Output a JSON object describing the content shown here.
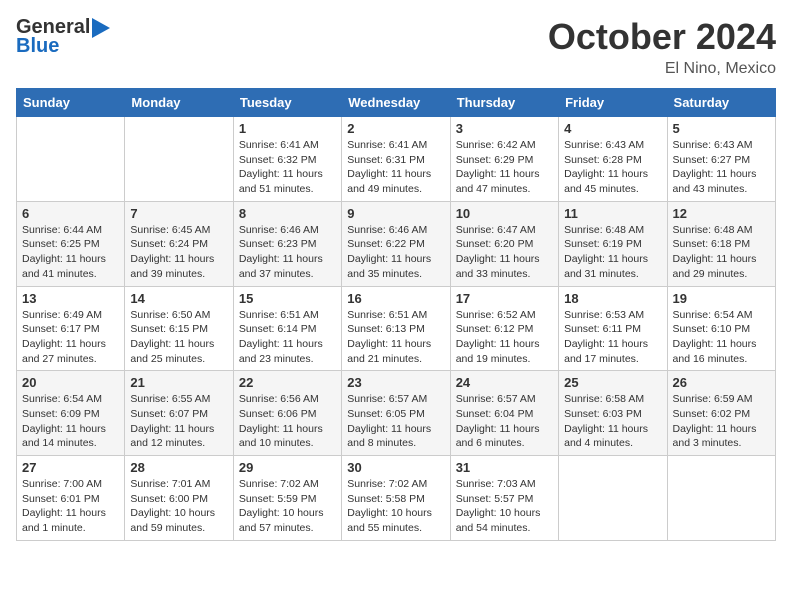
{
  "logo": {
    "general": "General",
    "blue": "Blue"
  },
  "header": {
    "month": "October 2024",
    "location": "El Nino, Mexico"
  },
  "weekdays": [
    "Sunday",
    "Monday",
    "Tuesday",
    "Wednesday",
    "Thursday",
    "Friday",
    "Saturday"
  ],
  "weeks": [
    [
      {
        "day": null
      },
      {
        "day": null
      },
      {
        "day": "1",
        "sunrise": "Sunrise: 6:41 AM",
        "sunset": "Sunset: 6:32 PM",
        "daylight": "Daylight: 11 hours and 51 minutes."
      },
      {
        "day": "2",
        "sunrise": "Sunrise: 6:41 AM",
        "sunset": "Sunset: 6:31 PM",
        "daylight": "Daylight: 11 hours and 49 minutes."
      },
      {
        "day": "3",
        "sunrise": "Sunrise: 6:42 AM",
        "sunset": "Sunset: 6:29 PM",
        "daylight": "Daylight: 11 hours and 47 minutes."
      },
      {
        "day": "4",
        "sunrise": "Sunrise: 6:43 AM",
        "sunset": "Sunset: 6:28 PM",
        "daylight": "Daylight: 11 hours and 45 minutes."
      },
      {
        "day": "5",
        "sunrise": "Sunrise: 6:43 AM",
        "sunset": "Sunset: 6:27 PM",
        "daylight": "Daylight: 11 hours and 43 minutes."
      }
    ],
    [
      {
        "day": "6",
        "sunrise": "Sunrise: 6:44 AM",
        "sunset": "Sunset: 6:25 PM",
        "daylight": "Daylight: 11 hours and 41 minutes."
      },
      {
        "day": "7",
        "sunrise": "Sunrise: 6:45 AM",
        "sunset": "Sunset: 6:24 PM",
        "daylight": "Daylight: 11 hours and 39 minutes."
      },
      {
        "day": "8",
        "sunrise": "Sunrise: 6:46 AM",
        "sunset": "Sunset: 6:23 PM",
        "daylight": "Daylight: 11 hours and 37 minutes."
      },
      {
        "day": "9",
        "sunrise": "Sunrise: 6:46 AM",
        "sunset": "Sunset: 6:22 PM",
        "daylight": "Daylight: 11 hours and 35 minutes."
      },
      {
        "day": "10",
        "sunrise": "Sunrise: 6:47 AM",
        "sunset": "Sunset: 6:20 PM",
        "daylight": "Daylight: 11 hours and 33 minutes."
      },
      {
        "day": "11",
        "sunrise": "Sunrise: 6:48 AM",
        "sunset": "Sunset: 6:19 PM",
        "daylight": "Daylight: 11 hours and 31 minutes."
      },
      {
        "day": "12",
        "sunrise": "Sunrise: 6:48 AM",
        "sunset": "Sunset: 6:18 PM",
        "daylight": "Daylight: 11 hours and 29 minutes."
      }
    ],
    [
      {
        "day": "13",
        "sunrise": "Sunrise: 6:49 AM",
        "sunset": "Sunset: 6:17 PM",
        "daylight": "Daylight: 11 hours and 27 minutes."
      },
      {
        "day": "14",
        "sunrise": "Sunrise: 6:50 AM",
        "sunset": "Sunset: 6:15 PM",
        "daylight": "Daylight: 11 hours and 25 minutes."
      },
      {
        "day": "15",
        "sunrise": "Sunrise: 6:51 AM",
        "sunset": "Sunset: 6:14 PM",
        "daylight": "Daylight: 11 hours and 23 minutes."
      },
      {
        "day": "16",
        "sunrise": "Sunrise: 6:51 AM",
        "sunset": "Sunset: 6:13 PM",
        "daylight": "Daylight: 11 hours and 21 minutes."
      },
      {
        "day": "17",
        "sunrise": "Sunrise: 6:52 AM",
        "sunset": "Sunset: 6:12 PM",
        "daylight": "Daylight: 11 hours and 19 minutes."
      },
      {
        "day": "18",
        "sunrise": "Sunrise: 6:53 AM",
        "sunset": "Sunset: 6:11 PM",
        "daylight": "Daylight: 11 hours and 17 minutes."
      },
      {
        "day": "19",
        "sunrise": "Sunrise: 6:54 AM",
        "sunset": "Sunset: 6:10 PM",
        "daylight": "Daylight: 11 hours and 16 minutes."
      }
    ],
    [
      {
        "day": "20",
        "sunrise": "Sunrise: 6:54 AM",
        "sunset": "Sunset: 6:09 PM",
        "daylight": "Daylight: 11 hours and 14 minutes."
      },
      {
        "day": "21",
        "sunrise": "Sunrise: 6:55 AM",
        "sunset": "Sunset: 6:07 PM",
        "daylight": "Daylight: 11 hours and 12 minutes."
      },
      {
        "day": "22",
        "sunrise": "Sunrise: 6:56 AM",
        "sunset": "Sunset: 6:06 PM",
        "daylight": "Daylight: 11 hours and 10 minutes."
      },
      {
        "day": "23",
        "sunrise": "Sunrise: 6:57 AM",
        "sunset": "Sunset: 6:05 PM",
        "daylight": "Daylight: 11 hours and 8 minutes."
      },
      {
        "day": "24",
        "sunrise": "Sunrise: 6:57 AM",
        "sunset": "Sunset: 6:04 PM",
        "daylight": "Daylight: 11 hours and 6 minutes."
      },
      {
        "day": "25",
        "sunrise": "Sunrise: 6:58 AM",
        "sunset": "Sunset: 6:03 PM",
        "daylight": "Daylight: 11 hours and 4 minutes."
      },
      {
        "day": "26",
        "sunrise": "Sunrise: 6:59 AM",
        "sunset": "Sunset: 6:02 PM",
        "daylight": "Daylight: 11 hours and 3 minutes."
      }
    ],
    [
      {
        "day": "27",
        "sunrise": "Sunrise: 7:00 AM",
        "sunset": "Sunset: 6:01 PM",
        "daylight": "Daylight: 11 hours and 1 minute."
      },
      {
        "day": "28",
        "sunrise": "Sunrise: 7:01 AM",
        "sunset": "Sunset: 6:00 PM",
        "daylight": "Daylight: 10 hours and 59 minutes."
      },
      {
        "day": "29",
        "sunrise": "Sunrise: 7:02 AM",
        "sunset": "Sunset: 5:59 PM",
        "daylight": "Daylight: 10 hours and 57 minutes."
      },
      {
        "day": "30",
        "sunrise": "Sunrise: 7:02 AM",
        "sunset": "Sunset: 5:58 PM",
        "daylight": "Daylight: 10 hours and 55 minutes."
      },
      {
        "day": "31",
        "sunrise": "Sunrise: 7:03 AM",
        "sunset": "Sunset: 5:57 PM",
        "daylight": "Daylight: 10 hours and 54 minutes."
      },
      {
        "day": null
      },
      {
        "day": null
      }
    ]
  ]
}
